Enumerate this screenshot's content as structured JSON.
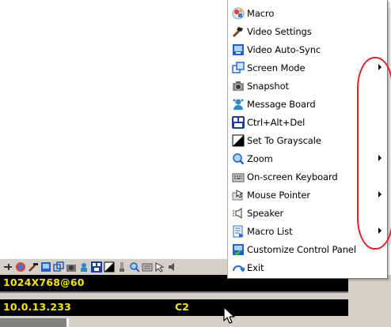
{
  "menu": {
    "items": [
      {
        "label": "Macro",
        "icon": "macro-icon",
        "submenu": false
      },
      {
        "label": "Video Settings",
        "icon": "video-settings-icon",
        "submenu": false
      },
      {
        "label": "Video Auto-Sync",
        "icon": "video-autosync-icon",
        "submenu": false
      },
      {
        "label": "Screen Mode",
        "icon": "screen-mode-icon",
        "submenu": true
      },
      {
        "label": "Snapshot",
        "icon": "snapshot-icon",
        "submenu": false
      },
      {
        "label": "Message Board",
        "icon": "message-board-icon",
        "submenu": false
      },
      {
        "label": "Ctrl+Alt+Del",
        "icon": "ctrl-alt-del-icon",
        "submenu": false
      },
      {
        "label": "Set To Grayscale",
        "icon": "grayscale-icon",
        "submenu": false
      },
      {
        "label": "Zoom",
        "icon": "zoom-icon",
        "submenu": true
      },
      {
        "label": "On-screen Keyboard",
        "icon": "keyboard-icon",
        "submenu": false
      },
      {
        "label": "Mouse Pointer",
        "icon": "mouse-pointer-icon",
        "submenu": true
      },
      {
        "label": "Speaker",
        "icon": "speaker-icon",
        "submenu": false
      },
      {
        "label": "Macro List",
        "icon": "macro-list-icon",
        "submenu": true
      },
      {
        "label": "Customize Control Panel",
        "icon": "customize-panel-icon",
        "submenu": false
      },
      {
        "label": "Exit",
        "icon": "exit-icon",
        "submenu": false
      }
    ]
  },
  "status": {
    "resolution": "1024X768@60",
    "ip": "10.0.13.233",
    "port": "C2"
  },
  "colors": {
    "status_text": "#f5e800",
    "status_bg": "#000000",
    "annotation": "#e8202a"
  }
}
